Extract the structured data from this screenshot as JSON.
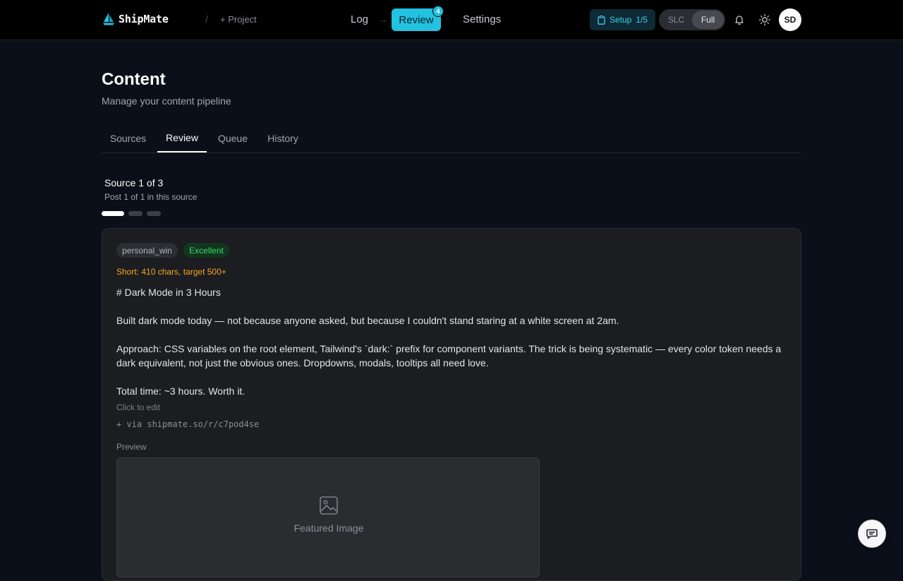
{
  "app": {
    "brand_name": "ShipMate",
    "breadcrumb_separator": "/",
    "project_button": "+ Project"
  },
  "nav": {
    "log": "Log",
    "arrow": "→",
    "review": "Review",
    "review_badge": "4",
    "dot": "·",
    "settings": "Settings"
  },
  "toolbar": {
    "setup_label": "Setup",
    "setup_count": "1/5",
    "mode_options": [
      "SLC",
      "Full"
    ],
    "mode_selected": "Full",
    "avatar_initials": "SD"
  },
  "header": {
    "title": "Content",
    "subtitle": "Manage your content pipeline"
  },
  "tabs": [
    {
      "label": "Sources",
      "active": false
    },
    {
      "label": "Review",
      "active": true
    },
    {
      "label": "Queue",
      "active": false
    },
    {
      "label": "History",
      "active": false
    }
  ],
  "source": {
    "title": "Source 1 of 3",
    "subtitle": "Post 1 of 1 in this source",
    "total": 3,
    "current": 1
  },
  "post": {
    "category_tag": "personal_win",
    "quality_tag": "Excellent",
    "length_warning": "Short: 410 chars, target 500+",
    "paragraphs": [
      "# Dark Mode in 3 Hours",
      "Built dark mode today — not because anyone asked, but because I couldn't stand staring at a white screen at 2am.",
      "Approach: CSS variables on the root element, Tailwind's `dark:` prefix for component variants. The trick is being systematic — every color token needs a dark equivalent, not just the obvious ones. Dropdowns, modals, tooltips all need love.",
      "Total time: ~3 hours. Worth it."
    ],
    "edit_hint": "Click to edit",
    "via_link": "+ via shipmate.so/r/c7pod4se",
    "preview_label": "Preview",
    "image_caption": "Featured Image"
  },
  "colors": {
    "accent": "#22c2e0",
    "background": "#0b0f1a",
    "card": "#1c1d20",
    "warning": "#f5a524",
    "success": "#3ed66c"
  },
  "icons": {
    "brand": "sailboat-icon",
    "setup": "clipboard-icon",
    "notifications": "bell-icon",
    "theme": "sun-icon",
    "image": "image-icon",
    "chat": "chat-icon"
  }
}
